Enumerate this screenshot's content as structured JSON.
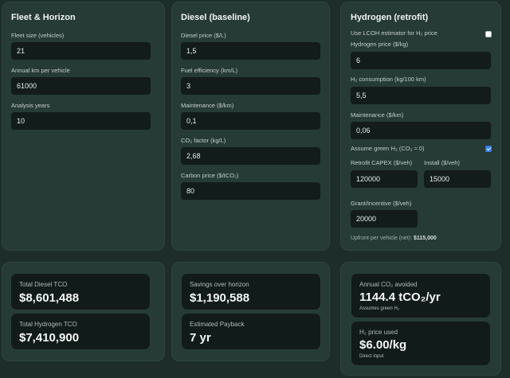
{
  "fleet": {
    "title": "Fleet & Horizon",
    "fleet_size": {
      "label": "Fleet size (vehicles)",
      "value": "21"
    },
    "annual_km": {
      "label": "Annual km per vehicle",
      "value": "61000"
    },
    "analysis_years": {
      "label": "Analysis years",
      "value": "10"
    }
  },
  "diesel": {
    "title": "Diesel (baseline)",
    "price": {
      "label": "Diesel price ($/L)",
      "value": "1,5"
    },
    "efficiency": {
      "label": "Fuel efficiency (km/L)",
      "value": "3"
    },
    "maintenance": {
      "label": "Maintenance ($/km)",
      "value": "0,1"
    },
    "co2_factor": {
      "label": "CO₂ factor (kg/L)",
      "value": "2,68"
    },
    "carbon_price": {
      "label": "Carbon price ($/tCO₂)",
      "value": "80"
    }
  },
  "hydrogen": {
    "title": "Hydrogen (retrofit)",
    "lcoh_label": "Use LCOH estimator for H₂ price",
    "lcoh_checked": false,
    "price": {
      "label": "Hydrogen price ($/kg)",
      "value": "6"
    },
    "consumption": {
      "label": "H₂ consumption (kg/100 km)",
      "value": "5,5"
    },
    "maintenance": {
      "label": "Maintenance ($/km)",
      "value": "0,06"
    },
    "green_label": "Assume green H₂ (CO₂ ≈ 0)",
    "green_checked": true,
    "capex": {
      "label": "Retrofit CAPEX ($/veh)",
      "value": "120000"
    },
    "install": {
      "label": "Install ($/veh)",
      "value": "15000"
    },
    "grant": {
      "label": "Grant/Incentive ($/veh)",
      "value": "20000"
    },
    "upfront_label": "Upfront per vehicle (net):",
    "upfront_value": "$115,000"
  },
  "results": {
    "total_diesel": {
      "label": "Total Diesel TCO",
      "value": "$8,601,488"
    },
    "total_hydrogen": {
      "label": "Total Hydrogen TCO",
      "value": "$7,410,900"
    },
    "savings": {
      "label": "Savings over horizon",
      "value": "$1,190,588"
    },
    "payback": {
      "label": "Estimated Payback",
      "value": "7 yr"
    },
    "co2_avoided": {
      "label": "Annual CO₂ avoided",
      "value": "1144.4 tCO₂/yr",
      "note": "Assumes green H₂"
    },
    "h2_price": {
      "label": "H₂ price used",
      "value": "$6.00/kg",
      "note": "Direct input"
    }
  },
  "colors": {
    "background": "#1d2d2a",
    "panel": "#263a36",
    "input": "#121c1a",
    "checkbox_on": "#3a7de8"
  }
}
